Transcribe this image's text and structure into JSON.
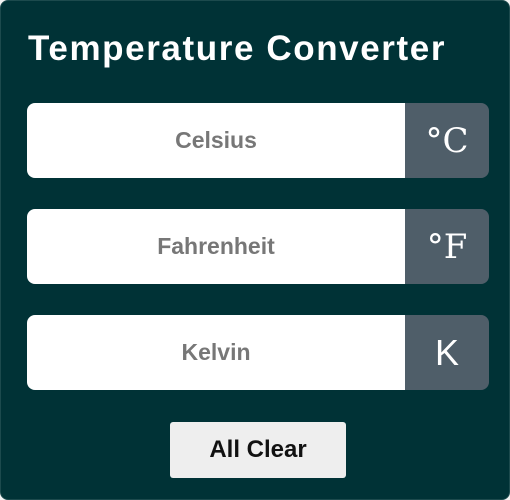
{
  "app": {
    "title": "Temperature Converter"
  },
  "fields": [
    {
      "id": "celsius",
      "placeholder": "Celsius",
      "value": "",
      "unit": "°C"
    },
    {
      "id": "fahrenheit",
      "placeholder": "Fahrenheit",
      "value": "",
      "unit": "°F"
    },
    {
      "id": "kelvin",
      "placeholder": "Kelvin",
      "value": "",
      "unit": "K"
    }
  ],
  "actions": {
    "clear_label": "All Clear"
  },
  "colors": {
    "background": "#003236",
    "unit_box": "#4f5e69",
    "input_bg": "#ffffff",
    "placeholder_text": "#777777",
    "button_bg": "#eeeeee"
  }
}
